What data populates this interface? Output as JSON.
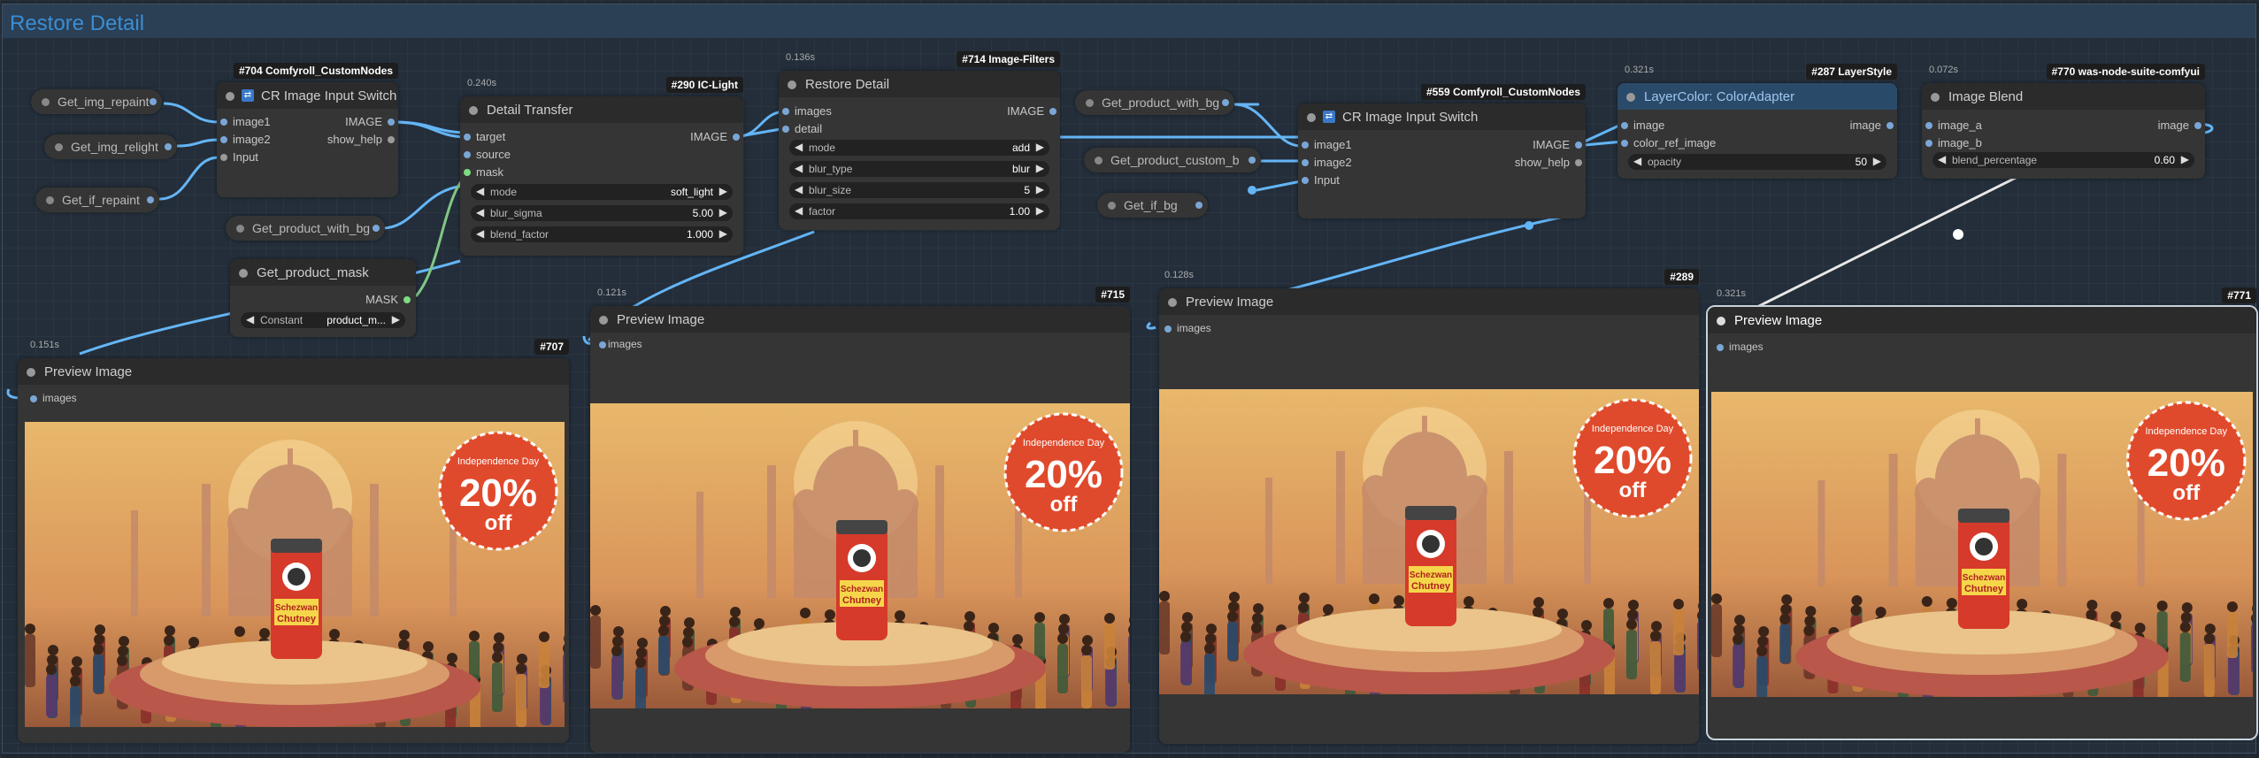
{
  "group": {
    "title": "Restore Detail"
  },
  "nodes": {
    "cr704": {
      "badge": "#704 Comfyroll_CustomNodes",
      "title": "CR Image Input Switch",
      "inputs": [
        "image1",
        "image2",
        "Input"
      ],
      "outputs": [
        "IMAGE",
        "show_help"
      ]
    },
    "dt290": {
      "time": "0.240s",
      "badge": "#290 IC-Light",
      "title": "Detail Transfer",
      "inputs": [
        "target",
        "source",
        "mask"
      ],
      "outputs": [
        "IMAGE"
      ],
      "widgets": [
        {
          "name": "mode",
          "value": "soft_light"
        },
        {
          "name": "blur_sigma",
          "value": "5.00"
        },
        {
          "name": "blend_factor",
          "value": "1.000"
        }
      ]
    },
    "rd714": {
      "time": "0.136s",
      "badge": "#714 Image-Filters",
      "title": "Restore Detail",
      "inputs": [
        "images",
        "detail"
      ],
      "outputs": [
        "IMAGE"
      ],
      "widgets": [
        {
          "name": "mode",
          "value": "add"
        },
        {
          "name": "blur_type",
          "value": "blur"
        },
        {
          "name": "blur_size",
          "value": "5"
        },
        {
          "name": "factor",
          "value": "1.00"
        }
      ]
    },
    "cr559": {
      "badge": "#559 Comfyroll_CustomNodes",
      "title": "CR Image Input Switch",
      "inputs": [
        "image1",
        "image2",
        "Input"
      ],
      "outputs": [
        "IMAGE",
        "show_help"
      ]
    },
    "lc287": {
      "time": "0.321s",
      "badge": "#287 LayerStyle",
      "title": "LayerColor: ColorAdapter",
      "inputs": [
        "image",
        "color_ref_image"
      ],
      "outputs": [
        "image"
      ],
      "widgets": [
        {
          "name": "opacity",
          "value": "50"
        }
      ]
    },
    "ib770": {
      "time": "0.072s",
      "badge": "#770 was-node-suite-comfyui",
      "title": "Image Blend",
      "inputs": [
        "image_a",
        "image_b"
      ],
      "outputs": [
        "image"
      ],
      "widgets": [
        {
          "name": "blend_percentage",
          "value": "0.60"
        }
      ]
    },
    "mask": {
      "title": "Get_product_mask",
      "output": "MASK",
      "constant_label": "Constant",
      "constant_value": "product_m..."
    },
    "p707": {
      "time": "0.151s",
      "badge": "#707",
      "title": "Preview Image",
      "input": "images"
    },
    "p715": {
      "time": "0.121s",
      "badge": "#715",
      "title": "Preview Image",
      "input": "images"
    },
    "p289": {
      "time": "0.128s",
      "badge": "#289",
      "title": "Preview Image",
      "input": "images"
    },
    "p771": {
      "time": "0.321s",
      "badge": "#771",
      "title": "Preview Image",
      "input": "images"
    }
  },
  "get_nodes": {
    "img_repaint": "Get_img_repaint",
    "img_relight": "Get_img_relight",
    "if_repaint": "Get_if_repaint",
    "product_with_bg_1": "Get_product_with_bg",
    "product_with_bg_2": "Get_product_with_bg",
    "product_custom_b": "Get_product_custom_b",
    "if_bg": "Get_if_bg"
  },
  "poster": {
    "badge_line1": "Independence Day",
    "badge_big": "20%",
    "badge_small": "off",
    "jar_line1": "Schezwan",
    "jar_line2": "Chutney"
  },
  "colors": {
    "image_wire": "#64b5f6",
    "mask_wire": "#81c784",
    "badge_red": "#e04a2c"
  }
}
